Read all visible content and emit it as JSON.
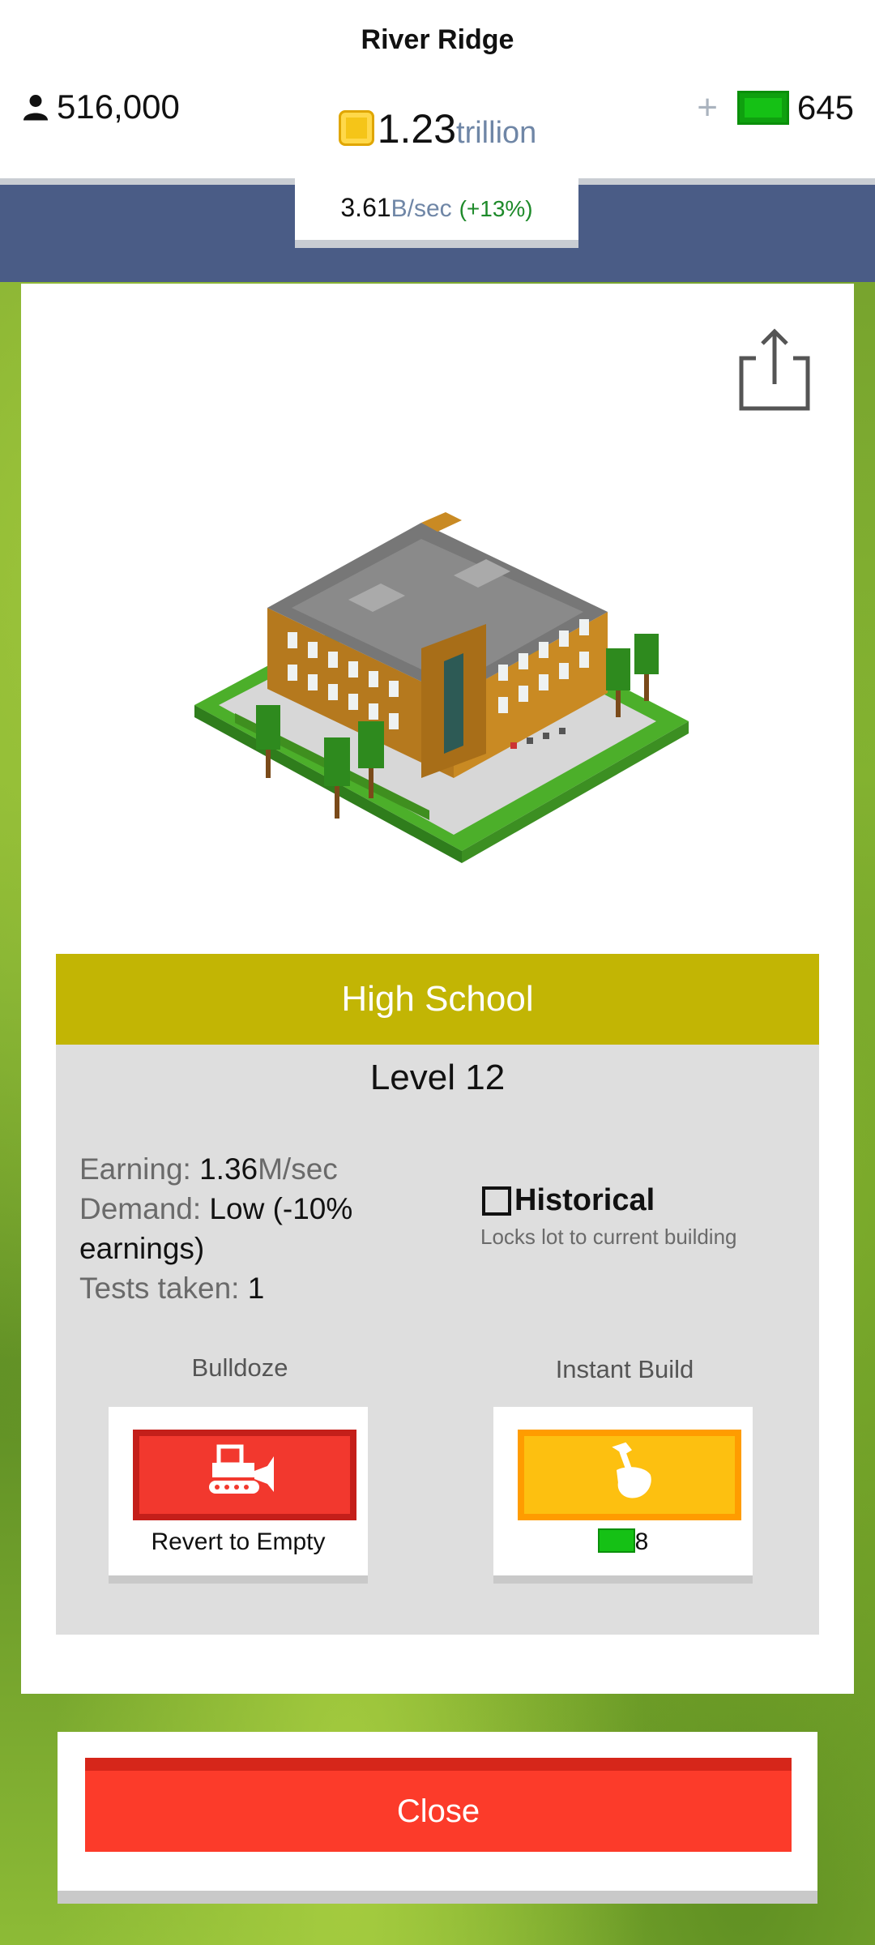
{
  "header": {
    "city_name": "River Ridge",
    "population": "516,000",
    "coins_value": "1.23",
    "coins_unit": "trillion",
    "cash_plus": "+",
    "cash_value": "645",
    "rate_value": "3.61",
    "rate_unit": "B/sec",
    "rate_change": "(+13%)"
  },
  "building": {
    "name": "High School",
    "level": "Level 12",
    "earning_label": "Earning:",
    "earning_value": "1.36",
    "earning_unit": "M/sec",
    "demand_label": "Demand:",
    "demand_value": "Low (-10% earnings)",
    "tests_label": "Tests taken:",
    "tests_value": "1",
    "historical_label": "Historical",
    "historical_checked": false,
    "historical_sub": "Locks lot to current building"
  },
  "actions": {
    "bulldoze_title": "Bulldoze",
    "bulldoze_caption": "Revert to Empty",
    "instant_title": "Instant Build",
    "instant_cost": "8"
  },
  "close_label": "Close",
  "colors": {
    "title_bar": "#c2b504",
    "bulldoze": "#f2382e",
    "instant": "#fdc010",
    "close": "#fc3b2a",
    "navy": "#4a5c86"
  },
  "icons": [
    "person-icon",
    "coin-icon",
    "cash-icon",
    "share-icon",
    "bulldozer-icon",
    "hammer-hand-icon"
  ]
}
